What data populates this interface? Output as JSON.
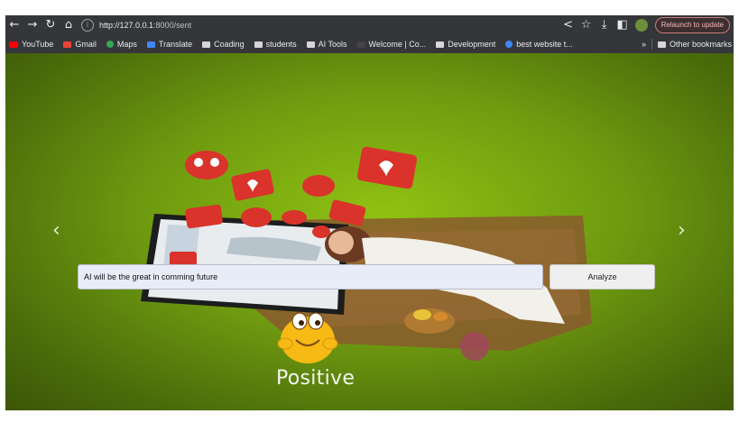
{
  "browser": {
    "url_host": "http://127.0.0.1",
    "url_path": ":8000/sent",
    "relaunch_label": "Relaunch to update"
  },
  "bookmarks": {
    "items": [
      {
        "label": "YouTube",
        "icon": "youtube-icon"
      },
      {
        "label": "Gmail",
        "icon": "gmail-icon"
      },
      {
        "label": "Maps",
        "icon": "maps-icon"
      },
      {
        "label": "Translate",
        "icon": "translate-icon"
      },
      {
        "label": "Coading",
        "icon": "folder-icon"
      },
      {
        "label": "students",
        "icon": "folder-icon"
      },
      {
        "label": "AI Tools",
        "icon": "folder-icon"
      },
      {
        "label": "Welcome | Co...",
        "icon": "page-icon"
      },
      {
        "label": "Development",
        "icon": "folder-icon"
      },
      {
        "label": "best website t...",
        "icon": "google-icon"
      }
    ],
    "other_bookmarks": "Other bookmarks"
  },
  "carousel": {
    "prev_icon": "chevron-left-icon",
    "next_icon": "chevron-right-icon"
  },
  "form": {
    "input_value": "AI will be the great in comming future",
    "analyze_label": "Analyze"
  },
  "result": {
    "sentiment_label": "Positive",
    "emoji_icon": "happy-emoji-icon"
  },
  "colors": {
    "background_green": "#6e9a10",
    "chrome_dark": "#35363a",
    "heart_red": "#d9332b"
  }
}
